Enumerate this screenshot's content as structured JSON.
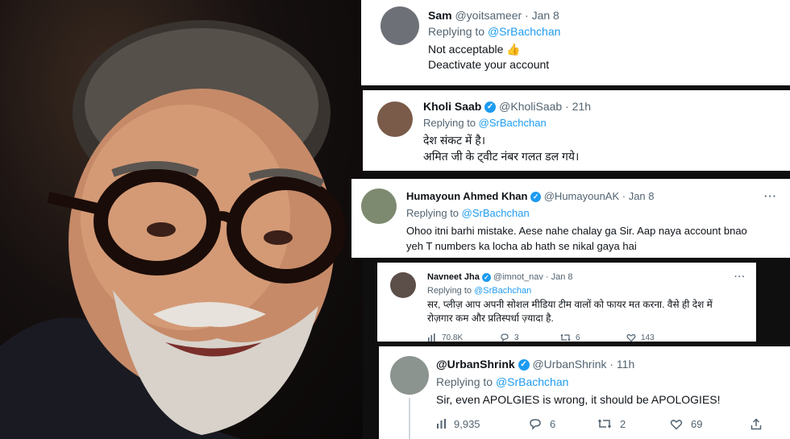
{
  "tweets": [
    {
      "name": "Sam",
      "handle": "@yoitsameer",
      "time": "· Jan 8",
      "replying_prefix": "Replying to ",
      "replying_to": "@SrBachchan",
      "line1": "Not acceptable 👍",
      "line2": "Deactivate your account"
    },
    {
      "name": "Kholi Saab",
      "handle": "@KholiSaab",
      "time": "· 21h",
      "replying_prefix": "Replying to ",
      "replying_to": "@SrBachchan",
      "line1": "देश संकट में है।",
      "line2": "अमित जी के ट्वीट नंबर गलत डल गये।"
    },
    {
      "name": "Humayoun Ahmed Khan",
      "handle": "@HumayounAK",
      "time": "· Jan 8",
      "more": "···",
      "replying_prefix": "Replying to ",
      "replying_to": "@SrBachchan",
      "line1": "Ohoo itni barhi mistake. Aese nahe chalay ga Sir. Aap naya account bnao",
      "line2": "yeh T numbers ka locha ab hath se nikal gaya hai"
    },
    {
      "name": "Navneet Jha",
      "handle": "@imnot_nav",
      "time": "· Jan 8",
      "more": "···",
      "replying_prefix": "Replying to ",
      "replying_to": "@SrBachchan",
      "line1": "सर, प्लीज़ आप अपनी सोशल मीडिया टीम वालों को फायर मत करना. वैसे ही देश में",
      "line2": "रोज़गार कम और प्रतिस्पर्धा ज़्यादा है.",
      "views": "70.8K",
      "replies": "3",
      "retweets": "6",
      "likes": "143"
    },
    {
      "name": "@UrbanShrink",
      "handle": "@UrbanShrink",
      "time": "· 11h",
      "replying_prefix": "Replying to ",
      "replying_to": "@SrBachchan",
      "line1": "Sir, even APOLGIES is wrong, it should be APOLOGIES!",
      "views": "9,935",
      "replies": "6",
      "retweets": "2",
      "likes": "69"
    }
  ],
  "verified_mark": "✓",
  "colors": {
    "link": "#1d9bf0",
    "muted": "#536471",
    "text": "#0f1419"
  }
}
